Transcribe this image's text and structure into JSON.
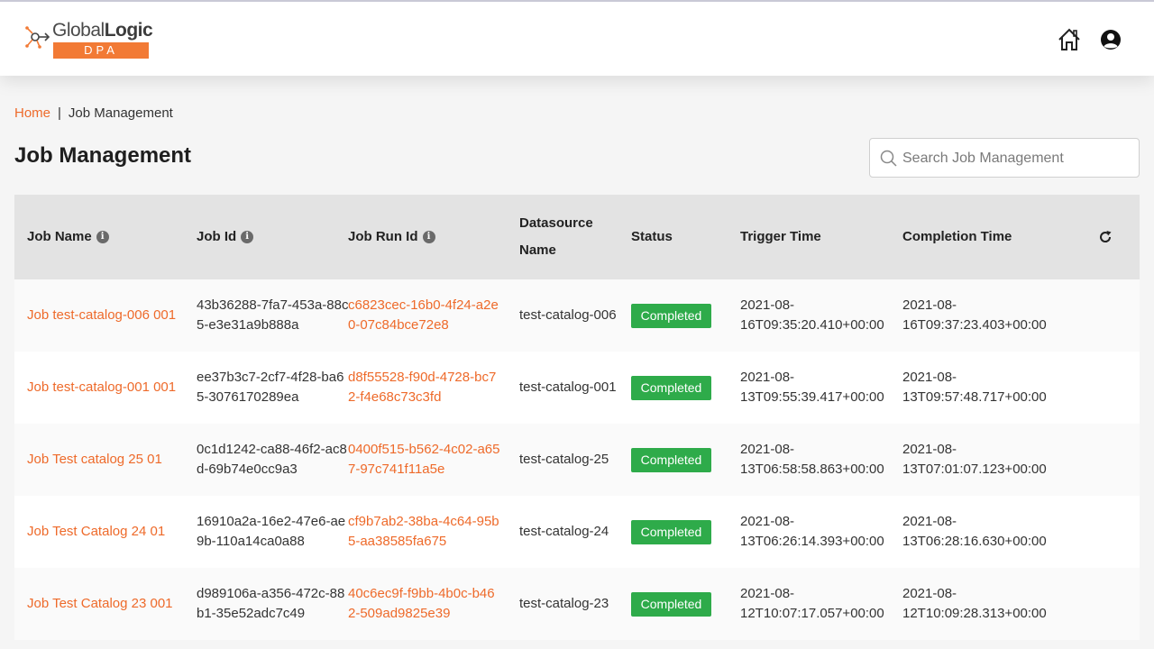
{
  "header": {
    "logo_text_regular": "Global",
    "logo_text_bold": "Logic",
    "logo_product": "DPA",
    "home_icon": "home-icon",
    "account_icon": "account-circle-icon"
  },
  "breadcrumb": {
    "home": "Home",
    "separator": "|",
    "current": "Job Management"
  },
  "page": {
    "title": "Job Management"
  },
  "search": {
    "placeholder": "Search Job Management",
    "value": ""
  },
  "table": {
    "columns": {
      "job_name": "Job Name",
      "job_id": "Job Id",
      "job_run_id": "Job Run Id",
      "datasource_line1": "Datasource",
      "datasource_line2": "Name",
      "status": "Status",
      "trigger_time": "Trigger Time",
      "completion_time": "Completion Time"
    },
    "rows": [
      {
        "job_name": "Job test-catalog-006 001",
        "job_id": "43b36288-7fa7-453a-88c5-e3e31a9b888a",
        "job_run_id": "c6823cec-16b0-4f24-a2e0-07c84bce72e8",
        "datasource": "test-catalog-006",
        "status": "Completed",
        "trigger_time_line1": "2021-08-",
        "trigger_time_line2": "16T09:35:20.410+00:00",
        "completion_time_line1": "2021-08-",
        "completion_time_line2": "16T09:37:23.403+00:00"
      },
      {
        "job_name": "Job test-catalog-001 001",
        "job_id": "ee37b3c7-2cf7-4f28-ba65-3076170289ea",
        "job_run_id": "d8f55528-f90d-4728-bc72-f4e68c73c3fd",
        "datasource": "test-catalog-001",
        "status": "Completed",
        "trigger_time_line1": "2021-08-",
        "trigger_time_line2": "13T09:55:39.417+00:00",
        "completion_time_line1": "2021-08-",
        "completion_time_line2": "13T09:57:48.717+00:00"
      },
      {
        "job_name": "Job Test catalog 25 01",
        "job_id": "0c1d1242-ca88-46f2-ac8d-69b74e0cc9a3",
        "job_run_id": "0400f515-b562-4c02-a657-97c741f11a5e",
        "datasource": "test-catalog-25",
        "status": "Completed",
        "trigger_time_line1": "2021-08-",
        "trigger_time_line2": "13T06:58:58.863+00:00",
        "completion_time_line1": "2021-08-",
        "completion_time_line2": "13T07:01:07.123+00:00"
      },
      {
        "job_name": "Job Test Catalog 24 01",
        "job_id": "16910a2a-16e2-47e6-ae9b-110a14ca0a88",
        "job_run_id": "cf9b7ab2-38ba-4c64-95b5-aa38585fa675",
        "datasource": "test-catalog-24",
        "status": "Completed",
        "trigger_time_line1": "2021-08-",
        "trigger_time_line2": "13T06:26:14.393+00:00",
        "completion_time_line1": "2021-08-",
        "completion_time_line2": "13T06:28:16.630+00:00"
      },
      {
        "job_name": "Job Test Catalog 23 001",
        "job_id": "d989106a-a356-472c-88b1-35e52adc7c49",
        "job_run_id": "40c6ec9f-f9bb-4b0c-b462-509ad9825e39",
        "datasource": "test-catalog-23",
        "status": "Completed",
        "trigger_time_line1": "2021-08-",
        "trigger_time_line2": "12T10:07:17.057+00:00",
        "completion_time_line1": "2021-08-",
        "completion_time_line2": "12T10:09:28.313+00:00"
      }
    ]
  },
  "colors": {
    "accent": "#ee6a2a",
    "status_completed": "#2eab4a",
    "header_bg": "#e3e3e3"
  }
}
